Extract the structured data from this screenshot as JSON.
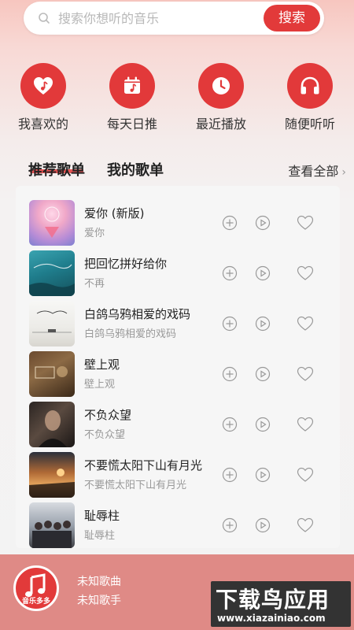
{
  "search": {
    "placeholder": "搜索你想听的音乐",
    "button_label": "搜索"
  },
  "quick_actions": [
    {
      "label": "我喜欢的",
      "icon": "heart-music-icon"
    },
    {
      "label": "每天日推",
      "icon": "calendar-music-icon"
    },
    {
      "label": "最近播放",
      "icon": "clock-icon"
    },
    {
      "label": "随便听听",
      "icon": "headphones-icon"
    }
  ],
  "tabs": {
    "recommended": "推荐歌单",
    "mine": "我的歌单",
    "see_all": "查看全部",
    "see_all_chevron": "›"
  },
  "songs": [
    {
      "title": "爱你 (新版)",
      "artist": "爱你"
    },
    {
      "title": "把回忆拼好给你",
      "artist": "不再"
    },
    {
      "title": "白鸽乌鸦相爱的戏码",
      "artist": "白鸽乌鸦相爱的戏码"
    },
    {
      "title": "壁上观",
      "artist": "壁上观"
    },
    {
      "title": "不负众望",
      "artist": "不负众望"
    },
    {
      "title": "不要慌太阳下山有月光",
      "artist": "不要慌太阳下山有月光"
    },
    {
      "title": "耻辱柱",
      "artist": "耻辱柱"
    }
  ],
  "player": {
    "song": "未知歌曲",
    "singer": "未知歌手",
    "logo_text": "音乐多多"
  },
  "watermark": {
    "big": "下载鸟应用",
    "small": "www.xiazainiao.com"
  },
  "colors": {
    "accent": "#e23a3a",
    "player_bg": "#df8a86"
  }
}
